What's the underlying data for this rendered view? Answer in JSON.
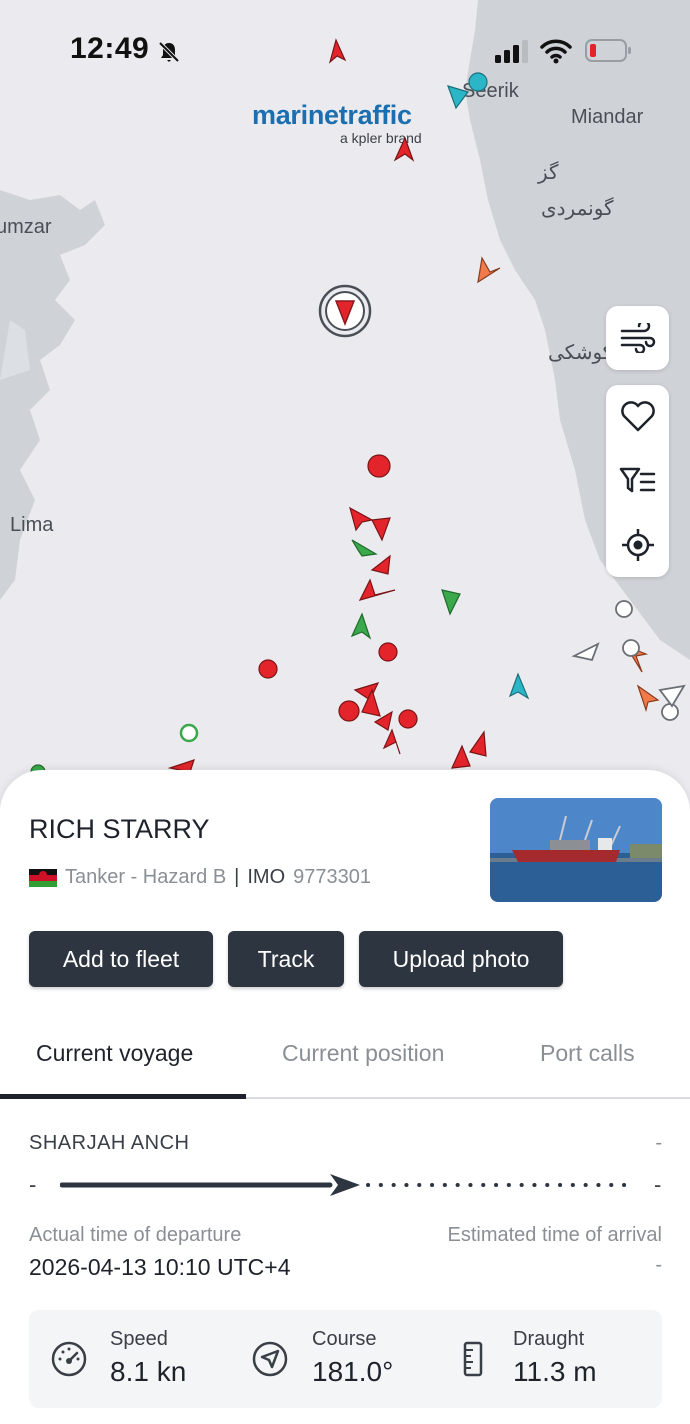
{
  "status_bar": {
    "time": "12:49"
  },
  "map": {
    "brand": "marinetraffic",
    "brand_sub": "a kpler brand",
    "places": [
      "Seerik",
      "Miandar",
      "گز",
      "گونمردی",
      "umzar",
      "کوشکی",
      "Lima"
    ],
    "controls": [
      "wind-icon",
      "heart-icon",
      "filter-list-icon",
      "locate-icon"
    ]
  },
  "vessel": {
    "name": "RICH STARRY",
    "type": "Tanker - Hazard B",
    "imo_label": "IMO",
    "imo": "9773301"
  },
  "actions": {
    "add_to_fleet": "Add to fleet",
    "track": "Track",
    "upload_photo": "Upload photo"
  },
  "tabs": [
    "Current voyage",
    "Current position",
    "Port calls"
  ],
  "voyage": {
    "from": "SHARJAH ANCH",
    "to": "-",
    "from_dash": "-",
    "to_dash": "-",
    "atd_label": "Actual time of departure",
    "atd_value": "2026-04-13 10:10 UTC+4",
    "eta_label": "Estimated time of arrival",
    "eta_value": "-"
  },
  "stats": {
    "speed_label": "Speed",
    "speed_value": "8.1 kn",
    "course_label": "Course",
    "course_value": "181.0°",
    "draught_label": "Draught",
    "draught_value": "11.3 m"
  },
  "colors": {
    "map_water": "#ebebef",
    "map_land": "#cfd3d8",
    "vessel_red": "#e3252b",
    "vessel_green": "#3aa84b",
    "vessel_orange": "#f07a4a",
    "vessel_cyan": "#2bb6c7",
    "button_dark": "#2d3540",
    "logo_blue": "#1b6fb0"
  }
}
